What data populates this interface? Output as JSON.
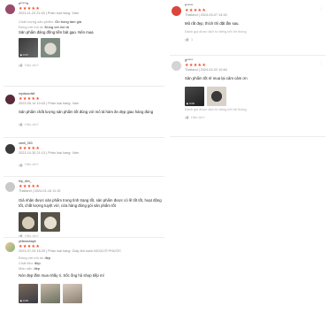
{
  "left_reviews": [
    {
      "username": "a*****a",
      "stars": "★★★★★",
      "date_variation": "2023-11-23 21:45 | Phân loại hàng: Xám",
      "fields": [
        {
          "key": "Chất lượng sản phẩm:",
          "value": "Ổn trong tầm giá"
        },
        {
          "key": "Đúng với mô tả:",
          "value": "Đúng với mô tả"
        }
      ],
      "body": "Sản phẩm đáng đồng tiền bát gạo. Nên mua",
      "video_duration": "0:17",
      "helpful": "Hữu ích?"
    },
    {
      "username": "mydaocris6",
      "stars": "★★★★★",
      "date_variation": "2023-09-14 10:43 | Phân loại hàng: Xám",
      "body": "Sản phẩm chất lượng sản phẩm tốt đúng với mô tả hàm ăn đẹp giao hàng đúng",
      "helpful": "Hữu ích?"
    },
    {
      "username": "vanti_263",
      "stars": "★★★★★",
      "date_variation": "2023-10-30 21:13 | Phân loại hàng: Xám",
      "helpful": "Hữu ích?"
    },
    {
      "username": "hip_dim_",
      "stars": "★★★★★",
      "date_variation": "Thailand | 2024-01-16 11:15",
      "body": "Giá nhận được sản phẩm trong tình trạng tốt, sản phẩm được có lẽ tốt tốt, hoạt động tốt, chất lượng tuyệt vời, cửa hàng đóng gói sản phẩm tốt",
      "helpful": "Hữu ích?"
    },
    {
      "username": "yellowshape",
      "stars": "★★★★★",
      "date_variation": "2023-07-03 16:25 | Phân loại hàng: Giày đốt xanh NGỌC/Ô PHƯỚC",
      "fields": [
        {
          "key": "Đúng với mô tả:",
          "value": "đẹp"
        },
        {
          "key": "Chất liệu:",
          "value": "đẹp"
        },
        {
          "key": "Màu sắc:",
          "value": "đẹp"
        }
      ],
      "body": "Nón đẹp lắm mua nhầy ri. Sốc ống hộ shop tiếp mí",
      "video_duration": "0:16"
    }
  ],
  "right_reviews": [
    {
      "username": "t******",
      "stars": "★★★★★",
      "date_variation": "Thailand | 2024-03-07 14:16",
      "body": "Mũ rất đẹp, thích thì đặt lần sau.",
      "shop_reply": "Đánh giá được dịch từ tiếng bởi hệ thống",
      "helpful_count": "1"
    },
    {
      "username": "g*****",
      "stars": "★★★★★",
      "date_variation": "Thailand | 2024-02-02 10:48",
      "body": "Sản phẩm tốt rẻ mua lại cảm cảm ơn",
      "video_duration": "0:09",
      "shop_reply": "Đánh giá được dịch từ tiếng bởi hệ thống",
      "helpful": "Hữu ích?"
    }
  ],
  "colors": {
    "star": "#ee4d2d",
    "muted": "#999999",
    "divider": "#ececec"
  },
  "icons": {
    "like": "thumbs-up-icon",
    "more": "kebab-menu-icon",
    "play": "play-icon"
  }
}
